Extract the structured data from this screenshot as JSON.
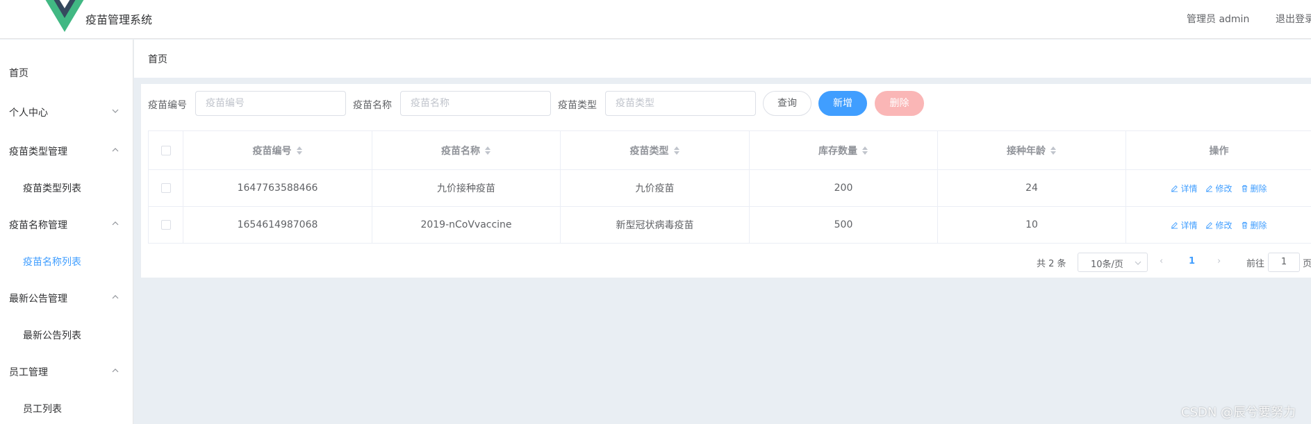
{
  "header": {
    "app_title": "疫苗管理系统",
    "admin_label": "管理员 admin",
    "logout_label": "退出登录"
  },
  "sidebar": {
    "home": "首页",
    "personal": "个人中心",
    "groups": [
      {
        "label": "疫苗类型管理",
        "sub": "疫苗类型列表"
      },
      {
        "label": "疫苗名称管理",
        "sub": "疫苗名称列表"
      },
      {
        "label": "最新公告管理",
        "sub": "最新公告列表"
      },
      {
        "label": "员工管理",
        "sub": "员工列表"
      }
    ],
    "active_sub": "疫苗名称列表"
  },
  "breadcrumb": {
    "home": "首页"
  },
  "filters": {
    "code_label": "疫苗编号",
    "code_placeholder": "疫苗编号",
    "name_label": "疫苗名称",
    "name_placeholder": "疫苗名称",
    "type_label": "疫苗类型",
    "type_placeholder": "疫苗类型",
    "query_button": "查询",
    "add_button": "新增",
    "delete_button": "删除"
  },
  "table": {
    "columns": [
      "疫苗编号",
      "疫苗名称",
      "疫苗类型",
      "库存数量",
      "接种年龄",
      "操作"
    ],
    "rows": [
      {
        "code": "1647763588466",
        "name": "九价接种疫苗",
        "type": "九价疫苗",
        "stock": "200",
        "age": "24"
      },
      {
        "code": "1654614987068",
        "name": "2019-nCoVvaccine",
        "type": "新型冠状病毒疫苗",
        "stock": "500",
        "age": "10"
      }
    ],
    "actions": {
      "detail": "详情",
      "edit": "修改",
      "delete": "删除"
    }
  },
  "pagination": {
    "total": "共 2 条",
    "page_size": "10条/页",
    "current_page": "1",
    "goto_label": "前往",
    "goto_value": "1",
    "page_unit": "页"
  },
  "watermark": "CSDN @辰兮要努力",
  "colors": {
    "primary": "#409eff",
    "danger_light": "#fab6b6",
    "logo_green": "#41b883",
    "logo_dark": "#35495e"
  }
}
